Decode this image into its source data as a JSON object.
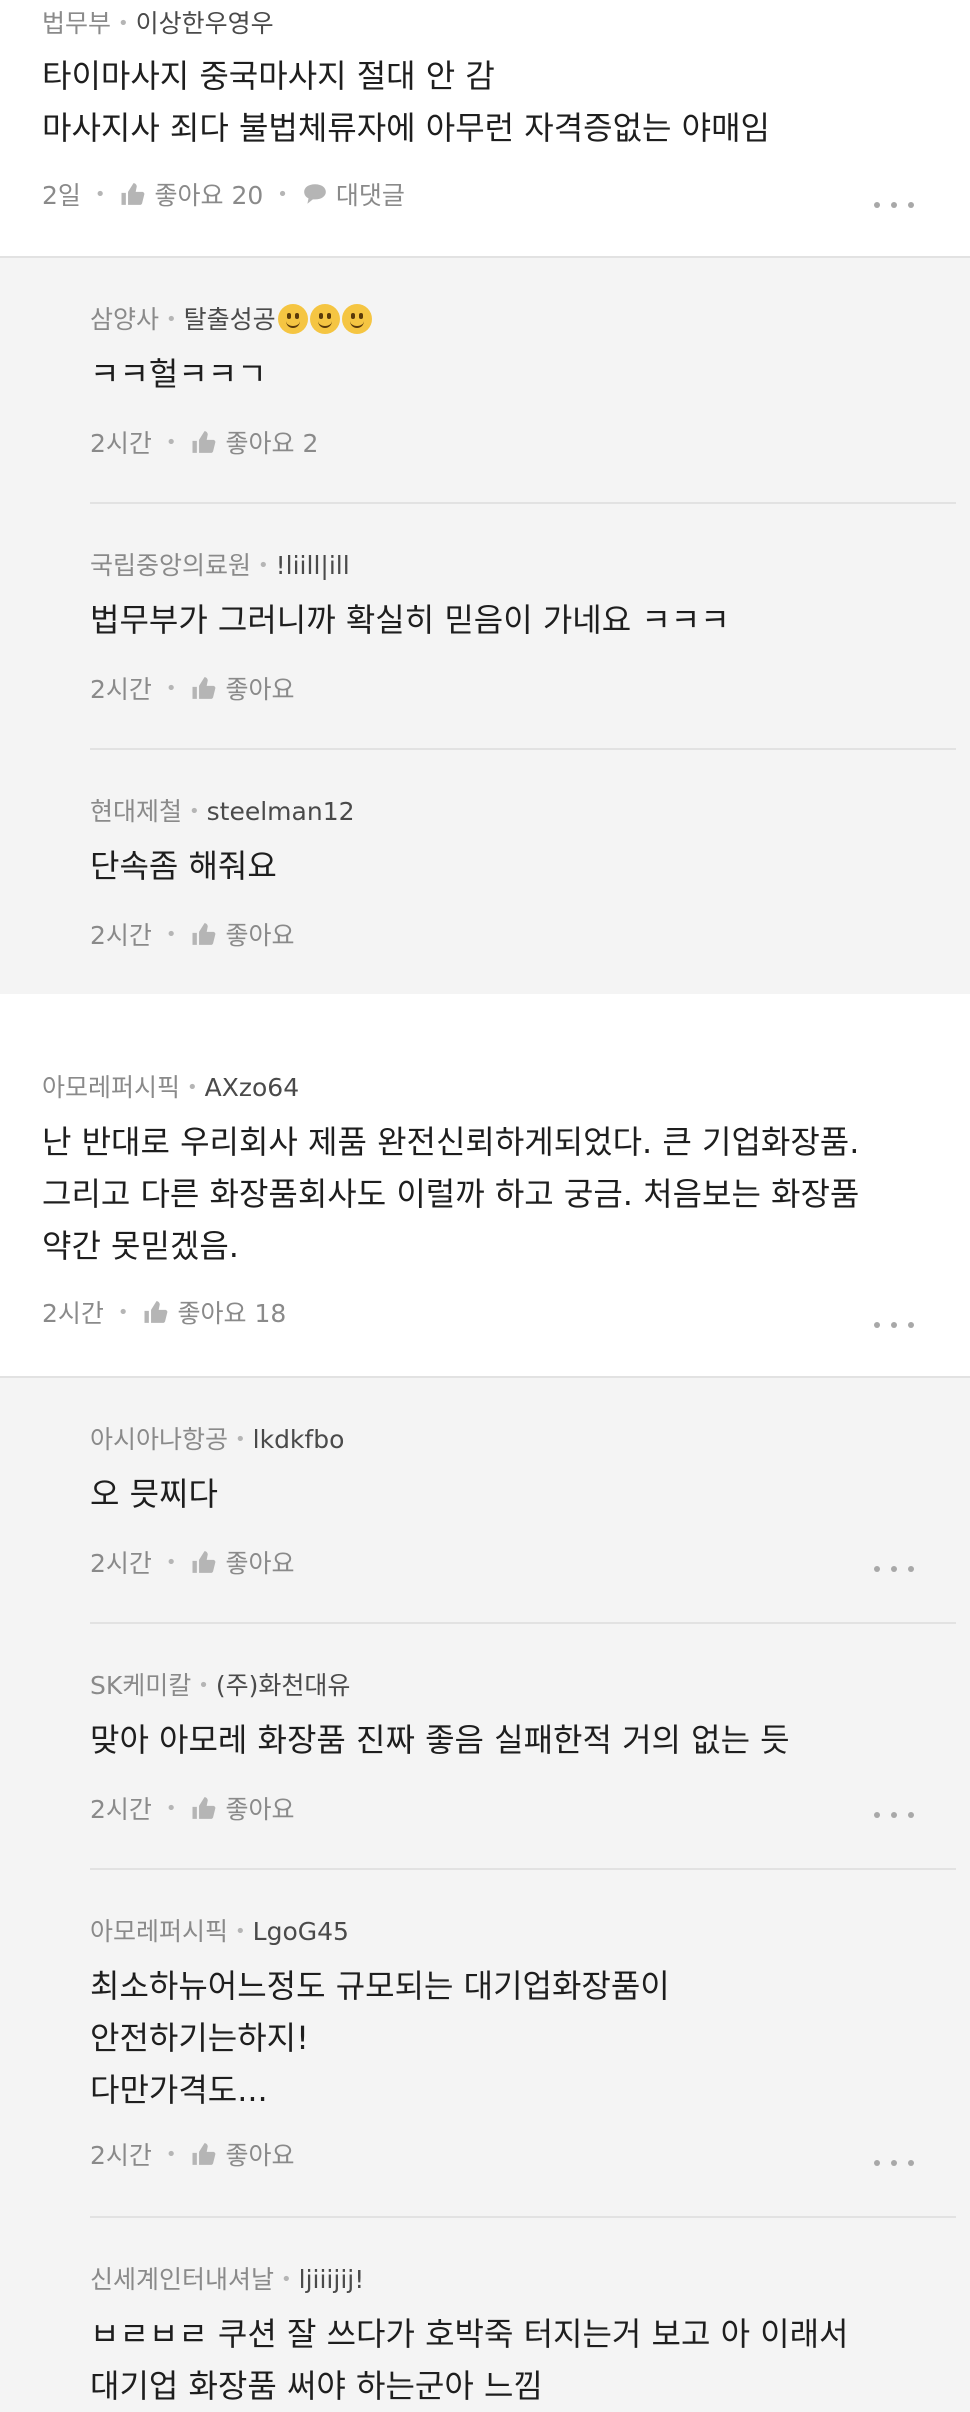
{
  "colors": {
    "reply_bg": "#f4f4f4",
    "top_bg": "#ffffff",
    "meta": "#8a8a8a",
    "text": "#1e1e1e"
  },
  "comments": [
    {
      "company": "법무부",
      "nick": "이상한우영우",
      "lines": [
        "타이마사지 중국마사지 절대 안 감",
        "마사지사 죄다 불법체류자에 아무런 자격증없는 야매임"
      ],
      "time": "2일",
      "like_label": "좋아요 20",
      "reply_label": "대댓글"
    },
    {
      "company": "삼양사",
      "nick": "탈출성공",
      "emoji": [
        "smile",
        "smile",
        "smile"
      ],
      "lines": [
        "ㅋㅋ헐ㅋㅋㄱ"
      ],
      "time": "2시간",
      "like_label": "좋아요 2"
    },
    {
      "company": "국립중앙의료원",
      "nick": "!liill|ill",
      "lines": [
        "법무부가 그러니까 확실히 믿음이 가네요 ㅋㅋㅋ"
      ],
      "time": "2시간",
      "like_label": "좋아요"
    },
    {
      "company": "현대제철",
      "nick": "steelman12",
      "lines": [
        "단속좀 해줘요"
      ],
      "time": "2시간",
      "like_label": "좋아요"
    },
    {
      "company": "아모레퍼시픽",
      "nick": "AXzo64",
      "lines": [
        "난 반대로 우리회사 제품 완전신뢰하게되었다.  큰 기업화장품.",
        "그리고 다른 화장품회사도 이럴까 하고 궁금. 처음보는 화장품",
        "약간 못믿겠음."
      ],
      "time": "2시간",
      "like_label": "좋아요 18"
    },
    {
      "company": "아시아나항공",
      "nick": "lkdkfbo",
      "lines": [
        "오 믓찌다"
      ],
      "time": "2시간",
      "like_label": "좋아요"
    },
    {
      "company": "SK케미칼",
      "nick": "(주)화천대유",
      "lines": [
        "맞아 아모레 화장품 진짜 좋음 실패한적 거의 없는 듯"
      ],
      "time": "2시간",
      "like_label": "좋아요"
    },
    {
      "company": "아모레퍼시픽",
      "nick": "LgoG45",
      "lines": [
        "최소하뉴어느정도 규모되는 대기업화장품이",
        "안전하기는하지!",
        "다만가격도..."
      ],
      "time": "2시간",
      "like_label": "좋아요"
    },
    {
      "company": "신세계인터내셔날",
      "nick": "ljiiijij!",
      "lines": [
        "ㅂㄹㅂㄹ 쿠션 잘 쓰다가 호박죽 터지는거 보고 아 이래서",
        "대기업 화장품 써야 하는군아 느낌"
      ]
    }
  ]
}
